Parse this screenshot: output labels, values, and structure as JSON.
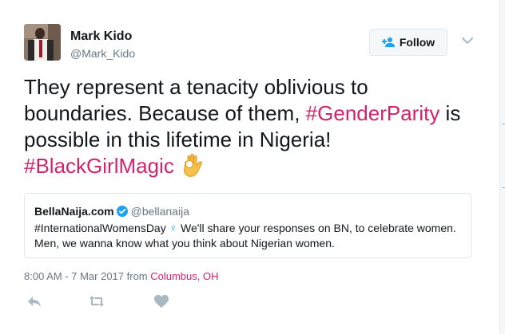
{
  "author": {
    "display_name": "Mark Kido",
    "screen_name": "@Mark_Kido"
  },
  "follow_button": {
    "label": "Follow",
    "icon": "follow-person-plus-icon"
  },
  "tweet": {
    "text_part1": "They represent a tenacity oblivious to boundaries. Because of them, ",
    "hashtag1": "#GenderParity",
    "text_part2": " is possible in this lifetime in Nigeria!",
    "hashtag2": "#BlackGirlMagic",
    "emoji": "ok-hand-emoji"
  },
  "quoted_tweet": {
    "name": "BellaNaija.com",
    "verified_icon": "verified-badge-icon",
    "handle": "@bellanaija",
    "text_part1": "#InternationalWomensDay",
    "symbol": "♀",
    "text_part2": " We'll share your responses on BN, to celebrate women. Men, we wanna know what you think about Nigerian women."
  },
  "timestamp": {
    "text": "8:00 AM - 7 Mar 2017 from ",
    "place": "Columbus, OH"
  },
  "actions": [
    "reply-icon",
    "retweet-icon",
    "like-heart-icon"
  ],
  "colors": {
    "text": "#14171a",
    "secondary": "#657786",
    "hashtag": "#d0246c",
    "accent": "#1da1f2",
    "border": "#e1e8ed",
    "button_bg": "#f5f8fa",
    "icon": "#aab8c2"
  }
}
